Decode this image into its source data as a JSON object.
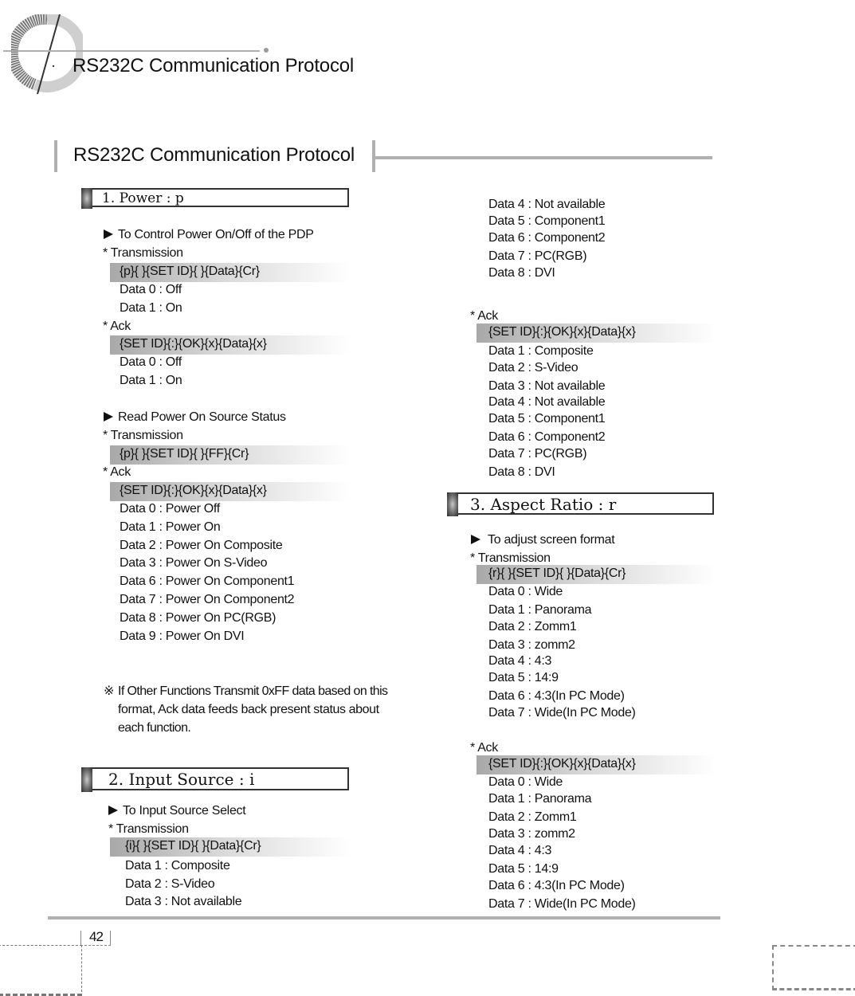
{
  "header": {
    "bullet": "·",
    "title": "RS232C Communication Protocol"
  },
  "section": {
    "title": "RS232C Communication Protocol"
  },
  "power": {
    "heading": "1. Power : p",
    "control": {
      "desc": "To Control Power On/Off of the PDP",
      "transmission_label": "* Transmission",
      "transmission_code": "{p}{ }{SET ID}{ }{Data}{Cr}",
      "transmission_data": [
        "Data 0 : Off",
        "Data 1 : On"
      ],
      "ack_label": "* Ack",
      "ack_code": "{SET ID}{:}{OK}{x}{Data}{x}",
      "ack_data": [
        "Data 0 : Off",
        "Data 1 : On"
      ]
    },
    "read_status": {
      "desc": "Read Power On Source Status",
      "transmission_label": "* Transmission",
      "transmission_code": "{p}{ }{SET ID}{ }{FF}{Cr}",
      "ack_label": "* Ack",
      "ack_code": "{SET ID}{:}{OK}{x}{Data}{x}",
      "ack_data": [
        "Data 0 : Power Off",
        "Data 1 : Power On",
        "Data 2 : Power On Composite",
        "Data 3 : Power On S-Video",
        "Data 6 : Power On Component1",
        "Data 7 : Power On Component2",
        "Data 8 : Power On PC(RGB)",
        "Data 9 : Power On DVI"
      ]
    },
    "note": {
      "mark": "※",
      "lines": [
        "If Other Functions Transmit 0xFF data based on this",
        "format, Ack data feeds back present status about",
        "each function."
      ]
    }
  },
  "input_source": {
    "heading": "2. Input Source : i",
    "desc": "To Input Source Select",
    "transmission_label": "* Transmission",
    "transmission_code": "{i}{ }{SET ID}{ }{Data}{Cr}",
    "transmission_data": [
      "Data 1 : Composite",
      "Data 2 : S-Video",
      "Data 3 : Not available",
      "Data 4 : Not available",
      "Data 5 : Component1",
      "Data 6 : Component2",
      "Data 7 : PC(RGB)",
      "Data 8 : DVI"
    ],
    "ack_label": "* Ack",
    "ack_code": "{SET ID}{:}{OK}{x}{Data}{x}",
    "ack_data": [
      "Data 1 : Composite",
      "Data 2 : S-Video",
      "Data 3 : Not available",
      "Data 4 : Not available",
      "Data 5 : Component1",
      "Data 6 : Component2",
      "Data 7 : PC(RGB)",
      "Data 8 : DVI"
    ]
  },
  "aspect_ratio": {
    "heading": "3. Aspect Ratio : r",
    "desc": "To adjust screen format",
    "transmission_label": "* Transmission",
    "transmission_code": "{r}{ }{SET ID}{ }{Data}{Cr}",
    "transmission_data": [
      "Data 0 : Wide",
      "Data 1 : Panorama",
      "Data 2 : Zomm1",
      "Data 3 : zomm2",
      "Data 4 : 4:3",
      "Data 5 : 14:9",
      "Data 6 : 4:3(In PC Mode)",
      "Data 7 : Wide(In PC Mode)"
    ],
    "ack_label": "* Ack",
    "ack_code": "{SET ID}{:}{OK}{x}{Data}{x}",
    "ack_data": [
      "Data 0 : Wide",
      "Data 1 : Panorama",
      "Data 2 : Zomm1",
      "Data 3 : zomm2",
      "Data 4 : 4:3",
      "Data 5 : 14:9",
      "Data 6 : 4:3(In PC Mode)",
      "Data 7 : Wide(In PC Mode)"
    ]
  },
  "footer": {
    "page_number": "42"
  }
}
